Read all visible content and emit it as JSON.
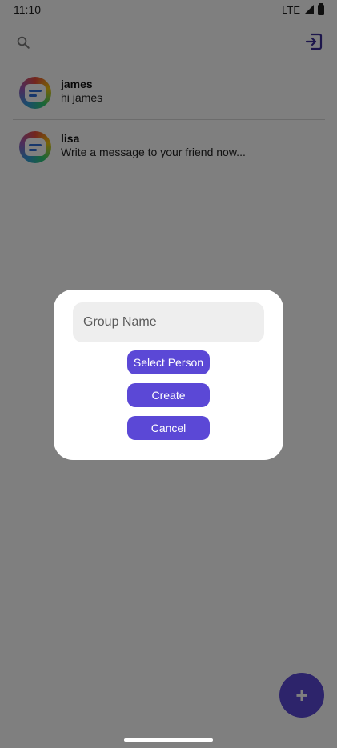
{
  "status_bar": {
    "time": "11:10",
    "network": "LTE"
  },
  "topbar": {
    "search_icon": "search-icon",
    "logout_icon": "logout-icon"
  },
  "chats": [
    {
      "name": "james",
      "last_message": "hi james"
    },
    {
      "name": "lisa",
      "last_message": "Write a message to your friend now..."
    }
  ],
  "dialog": {
    "group_name_placeholder": "Group Name",
    "select_person_label": "Select Person",
    "create_label": "Create",
    "cancel_label": "Cancel"
  },
  "fab": {
    "label": "+"
  },
  "colors": {
    "accent": "#5b48d6",
    "scrim": "rgba(0,0,0,0.5)"
  }
}
